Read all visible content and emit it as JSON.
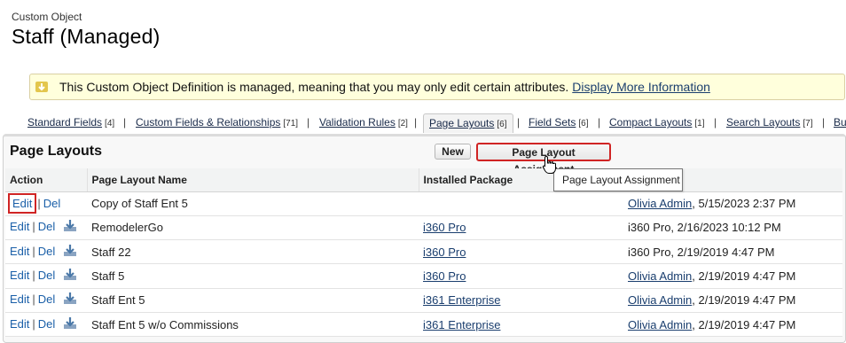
{
  "header": {
    "eyebrow": "Custom Object",
    "title": "Staff (Managed)"
  },
  "notice": {
    "text": "This Custom Object Definition is managed, meaning that you may only edit certain attributes.",
    "link": "Display More Information"
  },
  "tabs": [
    {
      "label": "Standard Fields",
      "count": "[4]"
    },
    {
      "label": "Custom Fields & Relationships",
      "count": "[71]"
    },
    {
      "label": "Validation Rules",
      "count": "[2]"
    },
    {
      "label": "Page Layouts",
      "count": "[6]"
    },
    {
      "label": "Field Sets",
      "count": "[6]"
    },
    {
      "label": "Compact Layouts",
      "count": "[1]"
    },
    {
      "label": "Search Layouts",
      "count": "[7]"
    },
    {
      "label": "Bu",
      "count": ""
    }
  ],
  "tab_separator": "|",
  "panel": {
    "title": "Page Layouts",
    "new_button": "New",
    "assign_button": "Page Layout Assignment",
    "tooltip": "Page Layout Assignment"
  },
  "table": {
    "headers": [
      "Action",
      "Page Layout Name",
      "Installed Package",
      ""
    ],
    "edit": "Edit",
    "del": "Del",
    "bar": "|",
    "rows": [
      {
        "name": "Copy of Staff Ent 5",
        "package": "",
        "modifier": "Olivia Admin",
        "date": ", 5/15/2023 2:37 PM"
      },
      {
        "name": "RemodelerGo",
        "package": "i360 Pro",
        "modifier": "",
        "date": "i360 Pro, 2/16/2023 10:12 PM"
      },
      {
        "name": "Staff 22",
        "package": "i360 Pro",
        "modifier": "",
        "date": "i360 Pro, 2/19/2019 4:47 PM"
      },
      {
        "name": "Staff 5",
        "package": "i360 Pro",
        "modifier": "Olivia Admin",
        "date": ", 2/19/2019 4:47 PM"
      },
      {
        "name": "Staff Ent 5",
        "package": "i361 Enterprise",
        "modifier": "Olivia Admin",
        "date": ", 2/19/2019 4:47 PM"
      },
      {
        "name": "Staff Ent 5 w/o Commissions",
        "package": "i361 Enterprise",
        "modifier": "Olivia Admin",
        "date": ", 2/19/2019 4:47 PM"
      }
    ]
  }
}
